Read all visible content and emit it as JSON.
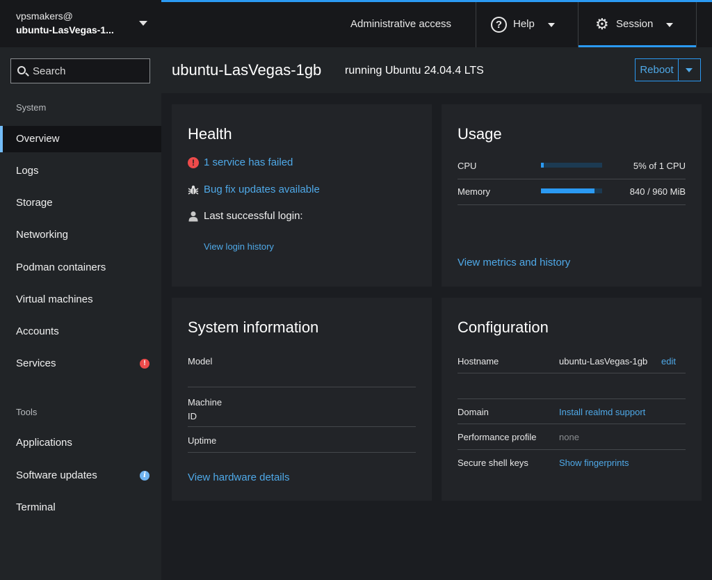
{
  "host_switcher": {
    "user": "vpsmakers@",
    "host": "ubuntu-LasVegas-1..."
  },
  "search": {
    "placeholder": "Search"
  },
  "nav": {
    "system_heading": "System",
    "system_items": [
      {
        "label": "Overview",
        "active": true
      },
      {
        "label": "Logs"
      },
      {
        "label": "Storage"
      },
      {
        "label": "Networking"
      },
      {
        "label": "Podman containers"
      },
      {
        "label": "Virtual machines"
      },
      {
        "label": "Accounts"
      },
      {
        "label": "Services",
        "badge": "!"
      }
    ],
    "tools_heading": "Tools",
    "tools_items": [
      {
        "label": "Applications"
      },
      {
        "label": "Software updates",
        "badge": "i"
      },
      {
        "label": "Terminal"
      }
    ]
  },
  "topbar": {
    "admin_access": "Administrative access",
    "help": {
      "icon": "?",
      "label": "Help"
    },
    "session": {
      "icon": "gear-icon",
      "label": "Session"
    }
  },
  "page": {
    "title": "ubuntu-LasVegas-1gb",
    "status": "running Ubuntu 24.04.4 LTS",
    "reboot_label": "Reboot"
  },
  "health": {
    "title": "Health",
    "failed_icon": "!",
    "failed_services": "1 service has failed",
    "updates": "Bug fix updates available",
    "last_login": "Last successful login:",
    "login_history": "View login history"
  },
  "usage": {
    "title": "Usage",
    "cpu": {
      "label": "CPU",
      "value": "5% of 1 CPU",
      "fraction": 0.05
    },
    "memory": {
      "label": "Memory",
      "value": "840 / 960 MiB",
      "fraction": 0.875
    },
    "metrics_link": "View metrics and history"
  },
  "sysinfo": {
    "title": "System information",
    "model_label": "Model",
    "machine_id_label_1": "Machine",
    "machine_id_label_2": "ID",
    "uptime_label": "Uptime",
    "hardware_link": "View hardware details"
  },
  "config": {
    "title": "Configuration",
    "hostname_label": "Hostname",
    "hostname_value": "ubuntu-LasVegas-1gb",
    "hostname_edit": "edit",
    "domain_label": "Domain",
    "domain_value": "Install realmd support",
    "perf_label": "Performance profile",
    "perf_value": "none",
    "ssh_label": "Secure shell keys",
    "ssh_value": "Show fingerprints"
  },
  "colors": {
    "accent": "#2b9af3",
    "danger": "#ee4b4b",
    "link": "#4fa9e8"
  }
}
